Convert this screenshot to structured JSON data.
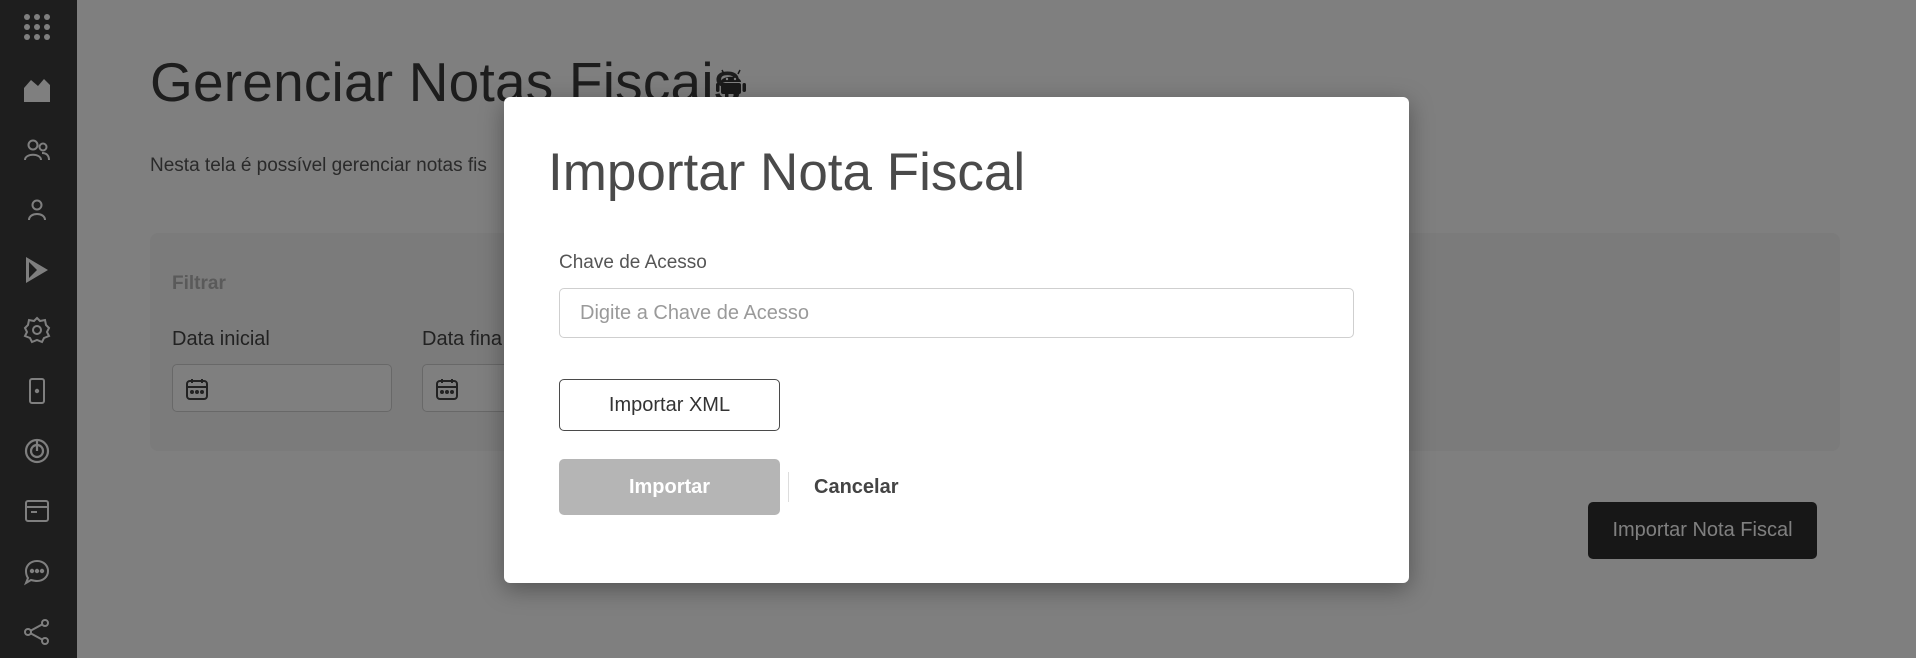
{
  "page": {
    "title": "Gerenciar Notas Fiscais",
    "description": "Nesta tela é possível gerenciar notas fis",
    "filter": {
      "title": "Filtrar",
      "date_start_label": "Data inicial",
      "date_end_label": "Data fina"
    },
    "main_action_label": "Importar Nota Fiscal"
  },
  "sidebar": {
    "icons": [
      "apps-grid-icon",
      "home-icon",
      "users-icon",
      "user-icon",
      "play-store-icon",
      "settings-icon",
      "mobile-icon",
      "target-icon",
      "browser-window-icon",
      "chat-icon",
      "share-icon"
    ]
  },
  "modal": {
    "title": "Importar Nota Fiscal",
    "access_key_label": "Chave de Acesso",
    "access_key_placeholder": "Digite a Chave de Acesso",
    "access_key_value": "",
    "import_xml_label": "Importar XML",
    "import_label": "Importar",
    "cancel_label": "Cancelar"
  },
  "colors": {
    "sidebar": "#3c3c3c",
    "overlay": "rgba(0,0,0,0.5)",
    "primary_dark": "#2e2e2e",
    "disabled_button": "#b5b5b5"
  }
}
